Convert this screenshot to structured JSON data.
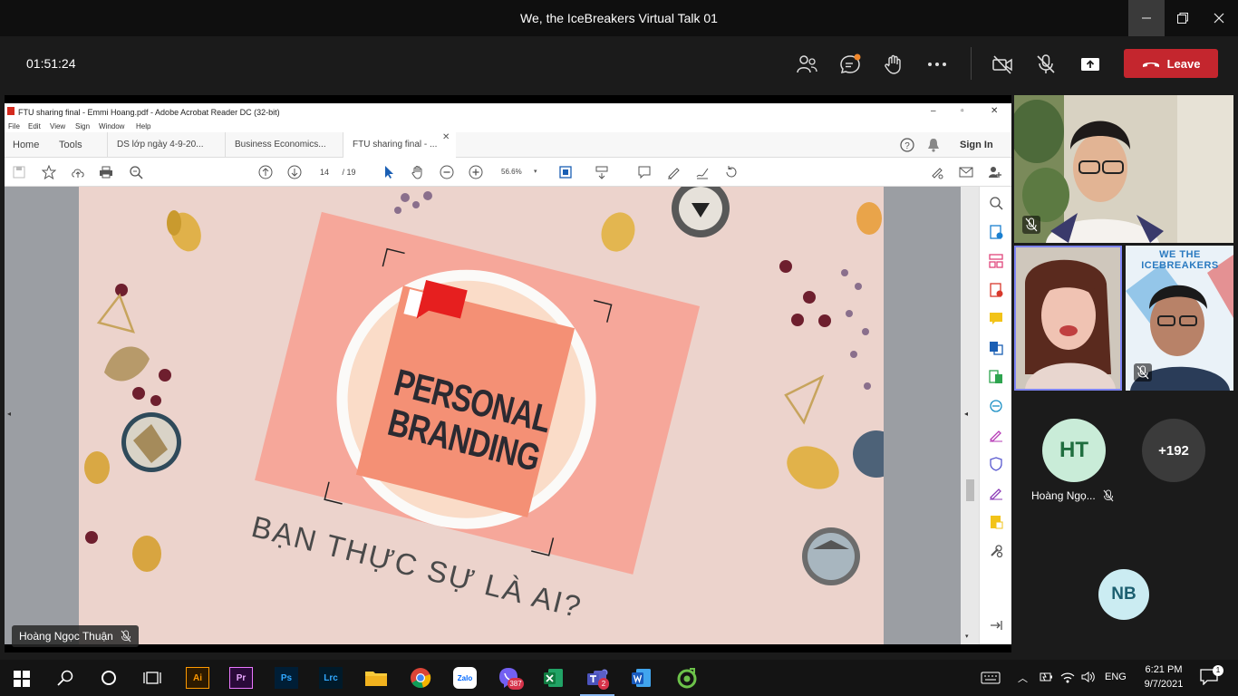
{
  "window": {
    "title": "We, the IceBreakers Virtual Talk 01"
  },
  "meeting": {
    "timer": "01:51:24",
    "leave_label": "Leave",
    "icons": [
      "people-icon",
      "chat-icon",
      "raise-hand-icon",
      "more-icon",
      "camera-off-icon",
      "mic-off-icon",
      "share-icon"
    ]
  },
  "acrobat": {
    "title": "FTU sharing final - Emmi Hoang.pdf - Adobe Acrobat Reader DC (32-bit)",
    "menu": [
      "File",
      "Edit",
      "View",
      "Sign",
      "Window",
      "Help"
    ],
    "nav": {
      "home": "Home",
      "tools": "Tools"
    },
    "tabs": [
      "DS lớp ngày 4-9-20...",
      "Business Economics...",
      "FTU sharing final - ..."
    ],
    "sign_in": "Sign In",
    "page_current": "14",
    "page_total": "/ 19",
    "zoom": "56.6%"
  },
  "slide": {
    "line1": "PERSONAL",
    "line2": "BRANDING",
    "subtitle": "BẠN THỰC SỰ LÀ AI?"
  },
  "presenter": {
    "name": "Hoàng Ngọc Thuận"
  },
  "participants": {
    "ht_initials": "HT",
    "ht_name": "Hoàng Ngọ...",
    "more_count": "+192",
    "nb_initials": "NB",
    "poster_text": "WE THE ICEBREAKERS"
  },
  "taskbar": {
    "apps": [
      "Ai",
      "Pr",
      "Ps",
      "Lrc",
      "Zalo"
    ],
    "viber_badge": "387",
    "teams_badge": "2",
    "language": "ENG",
    "time": "6:21 PM",
    "date": "9/7/2021",
    "notif_count": "1"
  },
  "colors": {
    "leave": "#c4262e",
    "slide_bg": "#e8cfc8",
    "card": "#f6a79a",
    "tile": "#f49075",
    "ht_avatar": "#c9ecd8",
    "nb_avatar": "#cbecf2"
  }
}
